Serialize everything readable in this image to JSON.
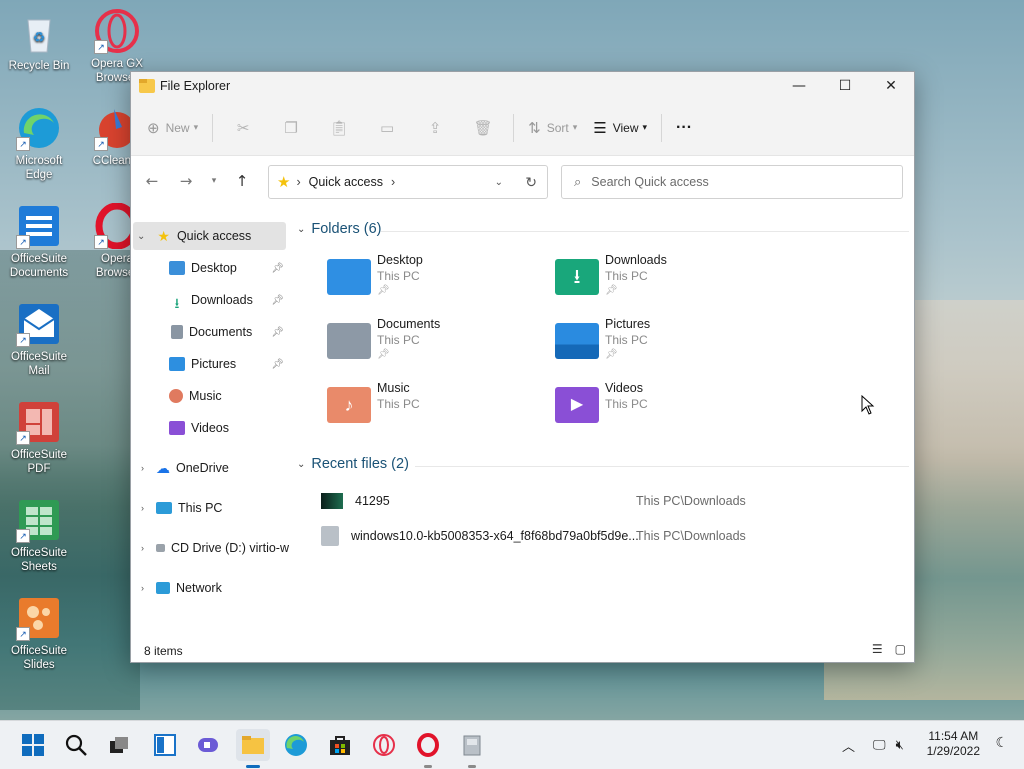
{
  "desktop": {
    "icons": [
      {
        "label_1": "Recycle Bin",
        "label_2": "",
        "icon": "recycle-bin-icon",
        "color": "#dfe7ef"
      },
      {
        "label_1": "Opera GX",
        "label_2": "Browser",
        "icon": "opera-gx-icon",
        "color": "#e6304a"
      },
      {
        "label_1": "Microsoft",
        "label_2": "Edge",
        "icon": "edge-icon",
        "color": "#1d9bd7"
      },
      {
        "label_1": "CCleaner",
        "label_2": "",
        "icon": "ccleaner-icon",
        "color": "#d9432f"
      },
      {
        "label_1": "OfficeSuite",
        "label_2": "Documents",
        "icon": "officesuite-documents-icon",
        "color": "#1f7bd8"
      },
      {
        "label_1": "Opera",
        "label_2": "Browser",
        "icon": "opera-icon",
        "color": "#e1132a"
      },
      {
        "label_1": "OfficeSuite",
        "label_2": "Mail",
        "icon": "officesuite-mail-icon",
        "color": "#1a6fc4"
      },
      {
        "label_1": "OfficeSuite",
        "label_2": "PDF",
        "icon": "officesuite-pdf-icon",
        "color": "#d0413a"
      },
      {
        "label_1": "OfficeSuite",
        "label_2": "Sheets",
        "icon": "officesuite-sheets-icon",
        "color": "#2f9a54"
      },
      {
        "label_1": "OfficeSuite",
        "label_2": "Slides",
        "icon": "officesuite-slides-icon",
        "color": "#e97b2c"
      }
    ]
  },
  "window": {
    "title": "File Explorer",
    "controls": {
      "minimize": "—",
      "maximize": "☐",
      "close": "✕"
    },
    "commandbar": {
      "new_label": "New",
      "sort_label": "Sort",
      "view_label": "View",
      "more_label": "···"
    },
    "address": {
      "location": "Quick access",
      "separator": "›"
    },
    "search": {
      "placeholder": "Search Quick access"
    },
    "sidebar": {
      "quick_access": "Quick access",
      "pinned": [
        {
          "label": "Desktop",
          "icon": "desktop-folder-icon",
          "color": "#3b8fd9"
        },
        {
          "label": "Downloads",
          "icon": "downloads-folder-icon",
          "color": "#1aa37a"
        },
        {
          "label": "Documents",
          "icon": "documents-folder-icon",
          "color": "#8a96a3"
        },
        {
          "label": "Pictures",
          "icon": "pictures-folder-icon",
          "color": "#2d8fe0"
        },
        {
          "label": "Music",
          "icon": "music-folder-icon",
          "color": "#e07a5f"
        },
        {
          "label": "Videos",
          "icon": "videos-folder-icon",
          "color": "#8a4fd6"
        }
      ],
      "onedrive": "OneDrive",
      "this_pc": "This PC",
      "cd_drive": "CD Drive (D:) virtio-w",
      "network": "Network"
    },
    "folders": {
      "header": "Folders (6)",
      "items": [
        {
          "name": "Desktop",
          "sub": "This PC",
          "pinned": true,
          "color": "#2f8fe3",
          "icon": "desktop-folder-icon"
        },
        {
          "name": "Downloads",
          "sub": "This PC",
          "pinned": true,
          "color": "#19a77b",
          "icon": "downloads-folder-icon"
        },
        {
          "name": "Documents",
          "sub": "This PC",
          "pinned": true,
          "color": "#8d99a6",
          "icon": "documents-folder-icon"
        },
        {
          "name": "Pictures",
          "sub": "This PC",
          "pinned": true,
          "color": "#2a8be0",
          "icon": "pictures-folder-icon"
        },
        {
          "name": "Music",
          "sub": "This PC",
          "pinned": false,
          "color": "#e98a6a",
          "icon": "music-folder-icon"
        },
        {
          "name": "Videos",
          "sub": "This PC",
          "pinned": false,
          "color": "#8a4fd6",
          "icon": "videos-folder-icon"
        }
      ]
    },
    "recent": {
      "header": "Recent files (2)",
      "items": [
        {
          "name": "41295",
          "location": "This PC\\Downloads",
          "icon": "image-file-icon"
        },
        {
          "name": "windows10.0-kb5008353-x64_f8f68bd79a0bf5d9e...",
          "location": "This PC\\Downloads",
          "icon": "installer-file-icon"
        }
      ]
    },
    "status": {
      "items": "8 items"
    }
  },
  "taskbar": {
    "time": "11:54 AM",
    "date": "1/29/2022"
  }
}
